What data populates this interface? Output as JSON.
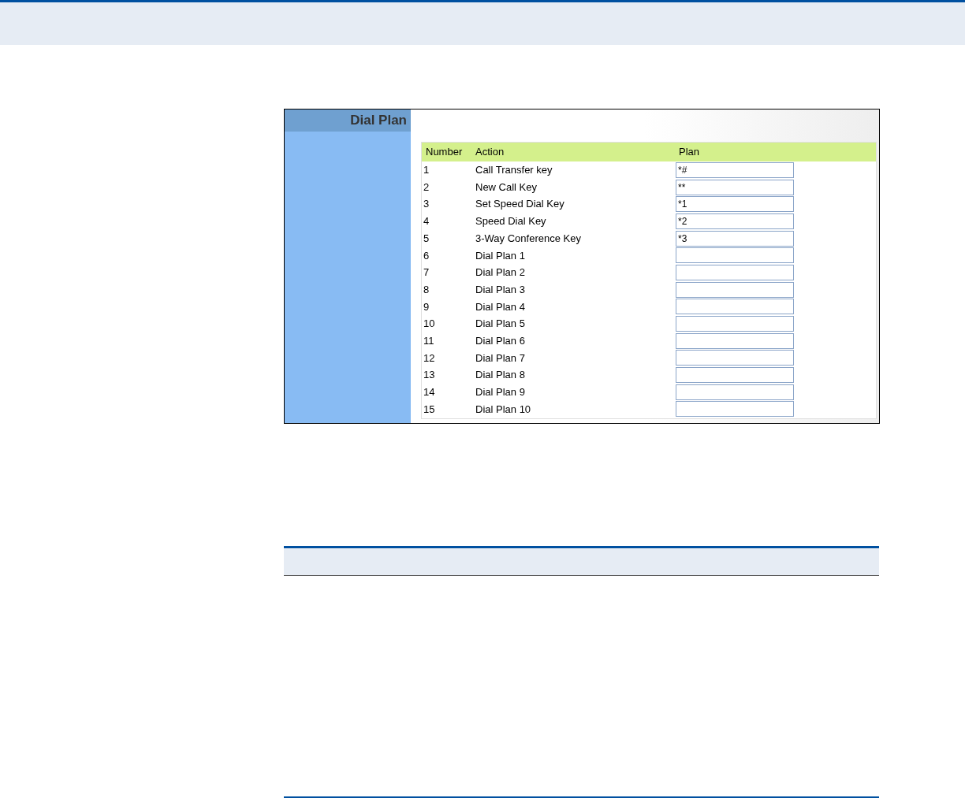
{
  "panel": {
    "title": "Dial Plan"
  },
  "table": {
    "columns": [
      "Number",
      "Action",
      "Plan"
    ],
    "rows": [
      {
        "number": "1",
        "action": "Call Transfer key",
        "plan": "*#"
      },
      {
        "number": "2",
        "action": "New Call Key",
        "plan": "**"
      },
      {
        "number": "3",
        "action": "Set Speed Dial Key",
        "plan": "*1"
      },
      {
        "number": "4",
        "action": "Speed Dial Key",
        "plan": "*2"
      },
      {
        "number": "5",
        "action": "3-Way Conference Key",
        "plan": "*3"
      },
      {
        "number": "6",
        "action": "Dial Plan 1"
      },
      {
        "number": "7",
        "action": "Dial Plan 2"
      },
      {
        "number": "8",
        "action": "Dial Plan 3"
      },
      {
        "number": "9",
        "action": "Dial Plan 4"
      },
      {
        "number": "10",
        "action": "Dial Plan 5"
      },
      {
        "number": "11",
        "action": "Dial Plan 6"
      },
      {
        "number": "12",
        "action": "Dial Plan 7"
      },
      {
        "number": "13",
        "action": "Dial Plan 8"
      },
      {
        "number": "14",
        "action": "Dial Plan 9"
      },
      {
        "number": "15",
        "action": "Dial Plan 10"
      }
    ]
  }
}
